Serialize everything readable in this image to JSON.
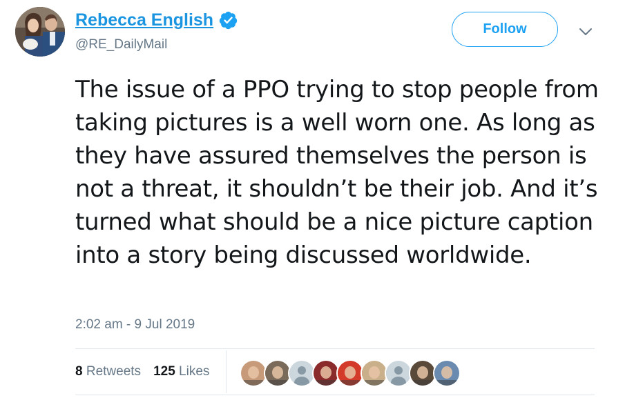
{
  "author": {
    "display_name": "Rebecca English",
    "handle": "@RE_DailyMail",
    "verified": true,
    "verified_color": "#1da1f2"
  },
  "follow_label": "Follow",
  "tweet": {
    "text": "The issue of a PPO trying to stop people from taking pictures is a well worn one. As long as they have assured themselves the person is not a threat, it shouldn’t be their job. And it’s turned what should be a nice picture caption into a story being discussed worldwide.",
    "timestamp": "2:02 am - 9 Jul 2019"
  },
  "stats": {
    "retweets_count": "8",
    "retweets_label": "Retweets",
    "likes_count": "125",
    "likes_label": "Likes"
  },
  "likers": [
    {
      "icon": "avatar-photo",
      "color": "#c79a7a"
    },
    {
      "icon": "avatar-photo",
      "color": "#7a6a5a"
    },
    {
      "icon": "default-avatar-icon",
      "color": "#ccd6dd"
    },
    {
      "icon": "avatar-photo",
      "color": "#8a2a2a"
    },
    {
      "icon": "avatar-photo",
      "color": "#d43a2a"
    },
    {
      "icon": "avatar-photo",
      "color": "#c9b08a"
    },
    {
      "icon": "default-avatar-icon",
      "color": "#ccd6dd"
    },
    {
      "icon": "avatar-photo",
      "color": "#5a4a3a"
    },
    {
      "icon": "avatar-photo",
      "color": "#6a8ab0"
    }
  ],
  "colors": {
    "link_blue": "#1b95e0",
    "twitter_blue": "#1da1f2",
    "secondary_text": "#657786",
    "primary_text": "#14171a",
    "divider": "#e1e8ed"
  }
}
